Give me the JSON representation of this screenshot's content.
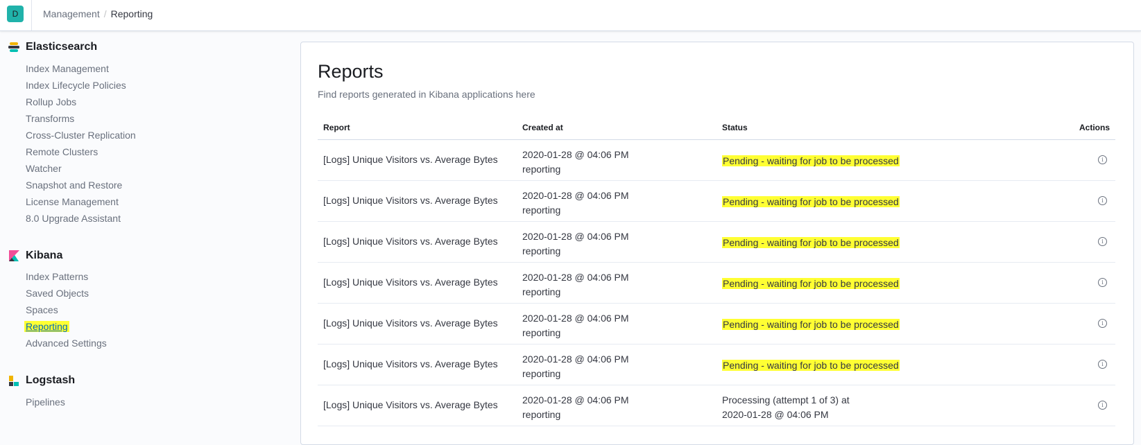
{
  "header": {
    "avatar": "D",
    "breadcrumbs": [
      "Management",
      "Reporting"
    ],
    "separator": "/"
  },
  "sidebar": {
    "groups": [
      {
        "title": "Elasticsearch",
        "icon": "elasticsearch-logo-icon",
        "items": [
          "Index Management",
          "Index Lifecycle Policies",
          "Rollup Jobs",
          "Transforms",
          "Cross-Cluster Replication",
          "Remote Clusters",
          "Watcher",
          "Snapshot and Restore",
          "License Management",
          "8.0 Upgrade Assistant"
        ]
      },
      {
        "title": "Kibana",
        "icon": "kibana-logo-icon",
        "items": [
          "Index Patterns",
          "Saved Objects",
          "Spaces",
          "Reporting",
          "Advanced Settings"
        ],
        "active": "Reporting"
      },
      {
        "title": "Logstash",
        "icon": "logstash-logo-icon",
        "items": [
          "Pipelines"
        ]
      }
    ]
  },
  "main": {
    "title": "Reports",
    "subtitle": "Find reports generated in Kibana applications here",
    "columns": [
      "Report",
      "Created at",
      "Status",
      "Actions"
    ],
    "rows": [
      {
        "report": "[Logs] Unique Visitors vs. Average Bytes",
        "created": "2020-01-28 @ 04:06 PM",
        "user": "reporting",
        "status": "Pending - waiting for job to be processed",
        "status2": ""
      },
      {
        "report": "[Logs] Unique Visitors vs. Average Bytes",
        "created": "2020-01-28 @ 04:06 PM",
        "user": "reporting",
        "status": "Pending - waiting for job to be processed",
        "status2": ""
      },
      {
        "report": "[Logs] Unique Visitors vs. Average Bytes",
        "created": "2020-01-28 @ 04:06 PM",
        "user": "reporting",
        "status": "Pending - waiting for job to be processed",
        "status2": ""
      },
      {
        "report": "[Logs] Unique Visitors vs. Average Bytes",
        "created": "2020-01-28 @ 04:06 PM",
        "user": "reporting",
        "status": "Pending - waiting for job to be processed",
        "status2": ""
      },
      {
        "report": "[Logs] Unique Visitors vs. Average Bytes",
        "created": "2020-01-28 @ 04:06 PM",
        "user": "reporting",
        "status": "Pending - waiting for job to be processed",
        "status2": ""
      },
      {
        "report": "[Logs] Unique Visitors vs. Average Bytes",
        "created": "2020-01-28 @ 04:06 PM",
        "user": "reporting",
        "status": "Pending - waiting for job to be processed",
        "status2": ""
      },
      {
        "report": "[Logs] Unique Visitors vs. Average Bytes",
        "created": "2020-01-28 @ 04:06 PM",
        "user": "reporting",
        "status": "Processing (attempt 1 of 3) at",
        "status2": "2020-01-28 @ 04:06 PM"
      }
    ],
    "action_icon": "info-icon"
  },
  "colors": {
    "highlight": "#ffff33",
    "accent": "#20b2aa",
    "link": "#006bb8"
  }
}
